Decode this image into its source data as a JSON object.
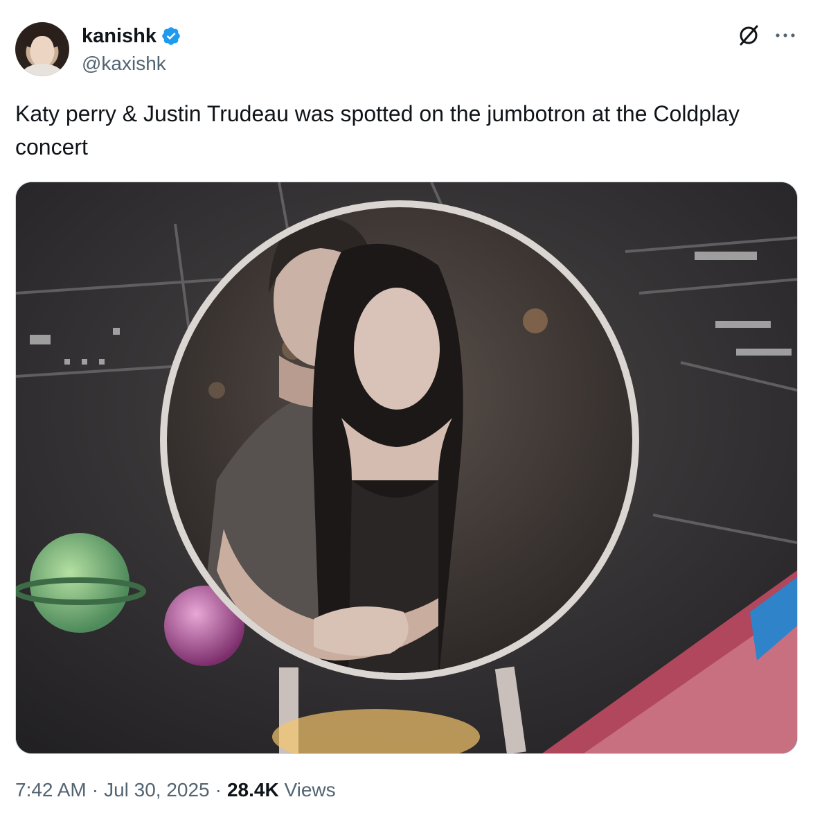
{
  "author": {
    "display_name": "kanishk",
    "handle": "@kaxishk",
    "verified": true
  },
  "header_icons": [
    "grok-icon",
    "more-options-icon"
  ],
  "tweet": {
    "text": "Katy perry & Justin Trudeau was spotted on the jumbotron at the Coldplay concert"
  },
  "meta": {
    "time": "7:42 AM",
    "separator": "·",
    "date": "Jul 30, 2025",
    "views_count": "28.4K",
    "views_label": "Views"
  },
  "colors": {
    "text_primary": "#0f1419",
    "text_secondary": "#536471",
    "verified_blue": "#1d9bf0",
    "border": "#cfd9de"
  }
}
